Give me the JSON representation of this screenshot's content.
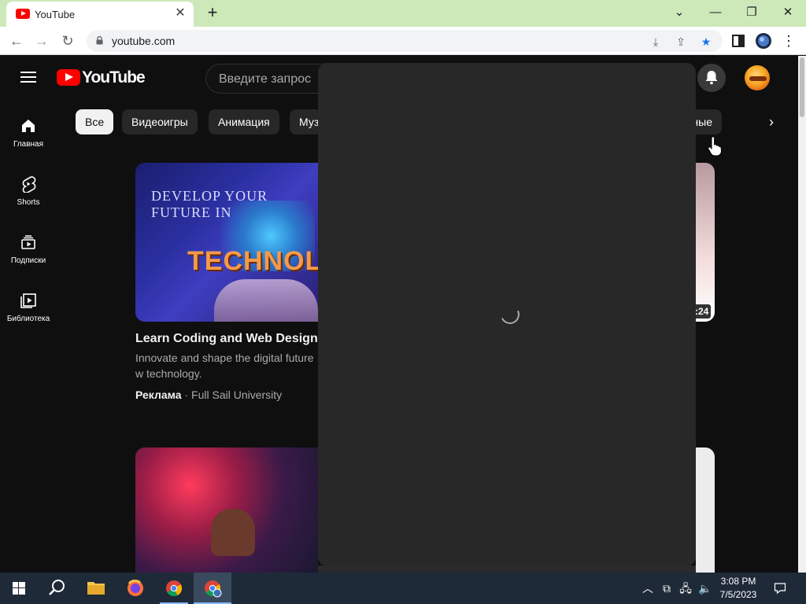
{
  "browser": {
    "tab_title": "YouTube",
    "url": "youtube.com"
  },
  "youtube": {
    "wordmark": "YouTube",
    "search_placeholder": "Введите запрос",
    "sidebar": [
      {
        "label": "Главная",
        "icon": "home-icon"
      },
      {
        "label": "Shorts",
        "icon": "shorts-icon"
      },
      {
        "label": "Подписки",
        "icon": "subscriptions-icon"
      },
      {
        "label": "Библиотека",
        "icon": "library-icon"
      }
    ],
    "chips": [
      "Все",
      "Видеоигры",
      "Анимация",
      "Муз",
      "ные"
    ],
    "video1": {
      "thumb_heading_line1": "DEVELOP YOUR",
      "thumb_heading_line2": "FUTURE IN",
      "thumb_word": "TECHNOL",
      "title": "Learn Coding and Web Design Te",
      "description": "Innovate and shape the digital future w technology.",
      "ad_label": "Реклама",
      "channel": "Full Sail University"
    },
    "duration_partial": ":24"
  },
  "taskbar": {
    "time": "3:08 PM",
    "date": "7/5/2023"
  },
  "colors": {
    "youtube_red": "#ff0000",
    "tabstrip_bg": "#cde8b9",
    "page_bg": "#0f0f0f",
    "panel_bg": "#282828",
    "taskbar_bg": "#1f2a38"
  }
}
